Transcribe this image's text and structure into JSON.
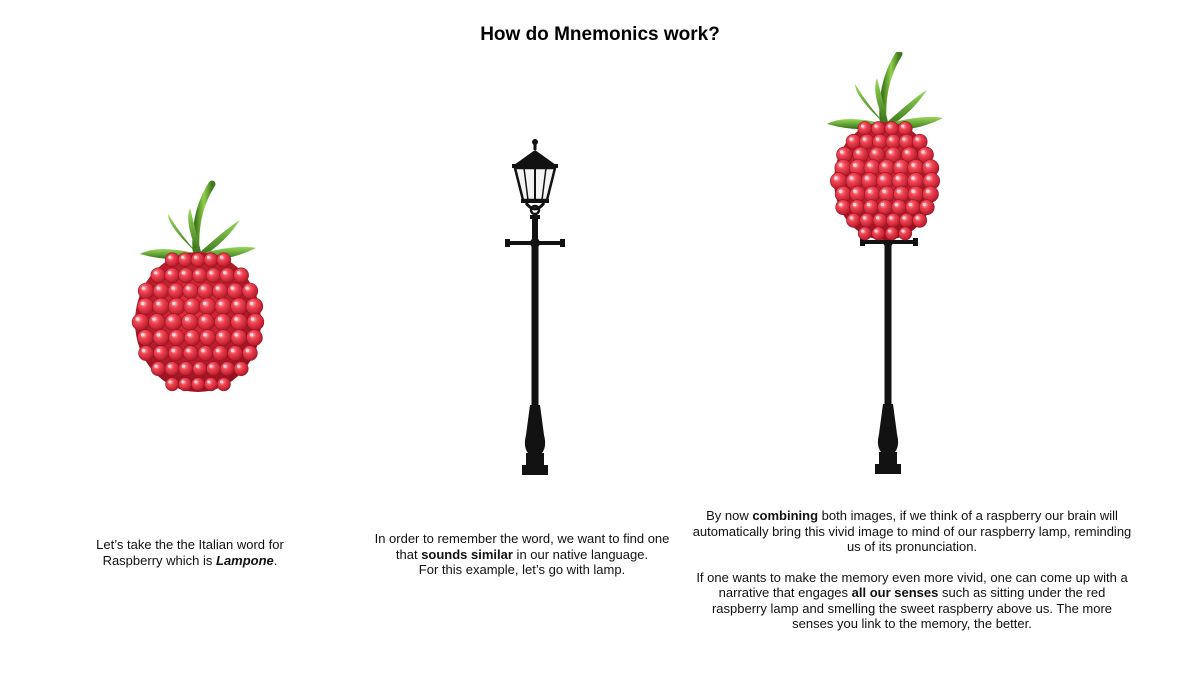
{
  "slide": {
    "title": "How do Mnemonics work?"
  },
  "panel_raspberry": {
    "image": "raspberry-icon",
    "caption_line1": "Let’s take the the Italian word for",
    "caption_line2_pre": "Raspberry which is ",
    "caption_word": "Lampone",
    "caption_line2_post": "."
  },
  "panel_lamp": {
    "image": "street-lamp-icon",
    "caption_line1": "In order to remember the word, we want to find one",
    "caption_line2_pre": "that ",
    "caption_bold": "sounds similar",
    "caption_line2_post": " in our native language.",
    "caption_line3": "For this example, let’s go with lamp."
  },
  "panel_combined": {
    "image": "raspberry-lamp-icon",
    "para1_pre": "By now ",
    "para1_bold": "combining",
    "para1_post": " both images, if we think of a raspberry our brain will automatically bring this vivid image to mind of our raspberry lamp, reminding us of its pronunciation.",
    "para2_pre": "If one wants to make the memory even more vivid, one can come up with a narrative that engages ",
    "para2_bold": "all our senses",
    "para2_post": " such as sitting under the red raspberry lamp and smelling the sweet raspberry above us. The more senses you link to the memory, the better."
  },
  "colors": {
    "raspberry": "#e23a45",
    "raspberry_dark": "#b51c2a",
    "leaf": "#5aa02c",
    "lamp": "#121212"
  }
}
